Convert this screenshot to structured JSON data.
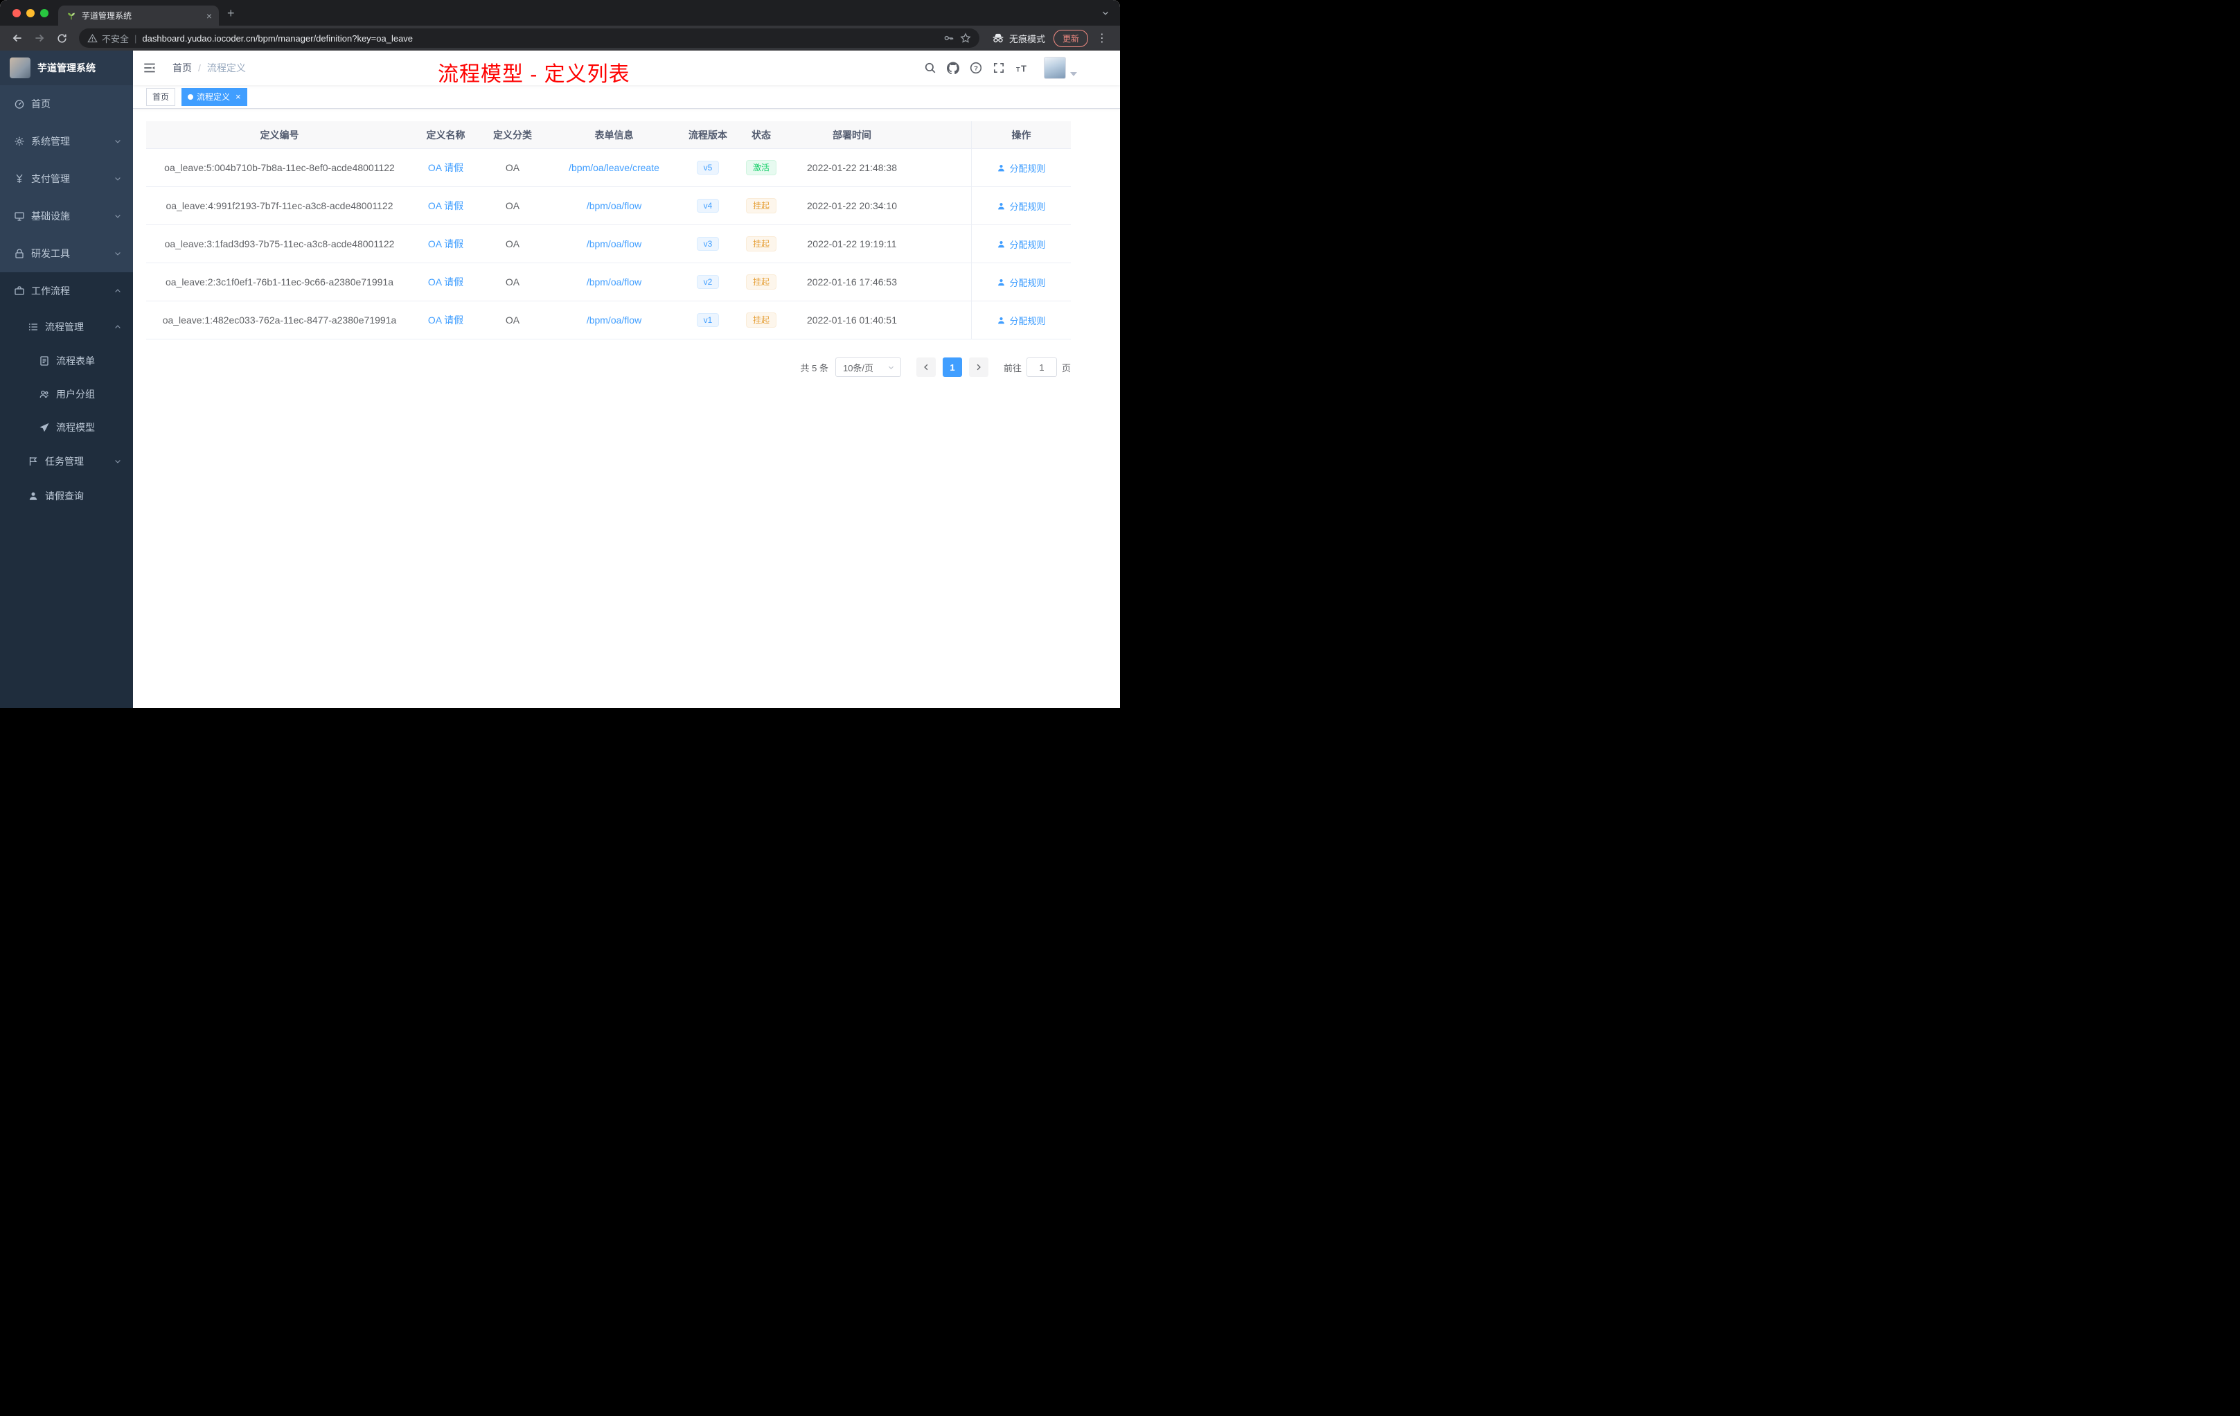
{
  "browser": {
    "tab_title": "芋道管理系统",
    "security_label": "不安全",
    "url": "dashboard.yudao.iocoder.cn/bpm/manager/definition?key=oa_leave",
    "incognito_label": "无痕模式",
    "update_label": "更新"
  },
  "glyphs": {
    "close": "×",
    "new_tab": "+",
    "more": "⋮",
    "pipe": "|"
  },
  "sidebar": {
    "title": "芋道管理系统",
    "items": [
      {
        "label": "首页"
      },
      {
        "label": "系统管理"
      },
      {
        "label": "支付管理"
      },
      {
        "label": "基础设施"
      },
      {
        "label": "研发工具"
      },
      {
        "label": "工作流程"
      },
      {
        "label": "流程管理"
      },
      {
        "label": "流程表单"
      },
      {
        "label": "用户分组"
      },
      {
        "label": "流程模型"
      },
      {
        "label": "任务管理"
      },
      {
        "label": "请假查询"
      }
    ]
  },
  "header": {
    "breadcrumb": [
      "首页",
      "流程定义"
    ],
    "breadcrumb_separator": "/",
    "annotation": "流程模型 - 定义列表"
  },
  "tags": {
    "items": [
      {
        "label": "首页"
      },
      {
        "label": "流程定义"
      }
    ]
  },
  "table": {
    "columns": [
      "定义编号",
      "定义名称",
      "定义分类",
      "表单信息",
      "流程版本",
      "状态",
      "部署时间",
      "操作"
    ],
    "rows": [
      {
        "id": "oa_leave:5:004b710b-7b8a-11ec-8ef0-acde48001122",
        "name": "OA 请假",
        "category": "OA",
        "form": "/bpm/oa/leave/create",
        "version": "v5",
        "status": "激活",
        "time": "2022-01-22 21:48:38",
        "action": "分配规则"
      },
      {
        "id": "oa_leave:4:991f2193-7b7f-11ec-a3c8-acde48001122",
        "name": "OA 请假",
        "category": "OA",
        "form": "/bpm/oa/flow",
        "version": "v4",
        "status": "挂起",
        "time": "2022-01-22 20:34:10",
        "action": "分配规则"
      },
      {
        "id": "oa_leave:3:1fad3d93-7b75-11ec-a3c8-acde48001122",
        "name": "OA 请假",
        "category": "OA",
        "form": "/bpm/oa/flow",
        "version": "v3",
        "status": "挂起",
        "time": "2022-01-22 19:19:11",
        "action": "分配规则"
      },
      {
        "id": "oa_leave:2:3c1f0ef1-76b1-11ec-9c66-a2380e71991a",
        "name": "OA 请假",
        "category": "OA",
        "form": "/bpm/oa/flow",
        "version": "v2",
        "status": "挂起",
        "time": "2022-01-16 17:46:53",
        "action": "分配规则"
      },
      {
        "id": "oa_leave:1:482ec033-762a-11ec-8477-a2380e71991a",
        "name": "OA 请假",
        "category": "OA",
        "form": "/bpm/oa/flow",
        "version": "v1",
        "status": "挂起",
        "time": "2022-01-16 01:40:51",
        "action": "分配规则"
      }
    ]
  },
  "pagination": {
    "total": "共 5 条",
    "page_size": "10条/页",
    "page": "1",
    "goto_label": "前往",
    "goto_value": "1",
    "page_unit": "页"
  }
}
